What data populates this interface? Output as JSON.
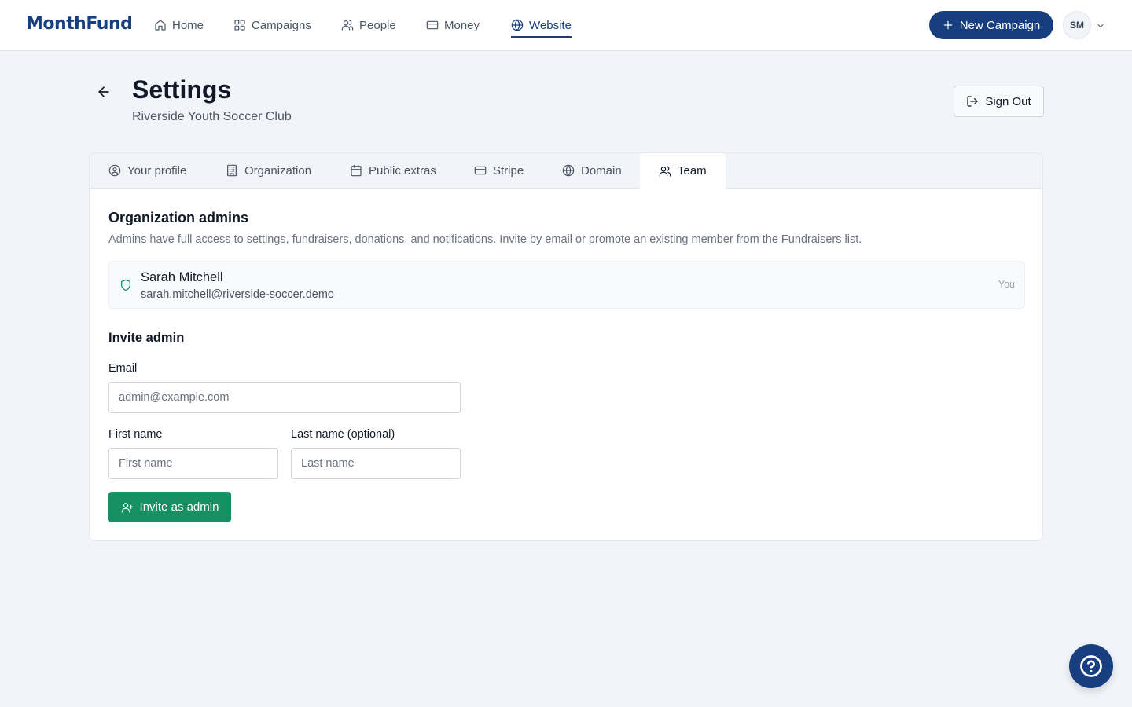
{
  "app": {
    "logo": "MonthFund"
  },
  "nav": {
    "items": [
      {
        "label": "Home",
        "icon": "home-icon"
      },
      {
        "label": "Campaigns",
        "icon": "grid-icon"
      },
      {
        "label": "People",
        "icon": "users-icon"
      },
      {
        "label": "Money",
        "icon": "credit-card-icon"
      },
      {
        "label": "Website",
        "icon": "globe-icon",
        "active": true
      }
    ],
    "new_campaign_label": "New Campaign",
    "avatar_initials": "SM"
  },
  "header": {
    "title": "Settings",
    "subtitle": "Riverside Youth Soccer Club",
    "sign_out_label": "Sign Out"
  },
  "tabs": [
    {
      "label": "Your profile",
      "icon": "user-circle-icon"
    },
    {
      "label": "Organization",
      "icon": "building-icon"
    },
    {
      "label": "Public extras",
      "icon": "calendar-icon"
    },
    {
      "label": "Stripe",
      "icon": "credit-card-icon"
    },
    {
      "label": "Domain",
      "icon": "globe-icon"
    },
    {
      "label": "Team",
      "icon": "users-icon",
      "active": true
    }
  ],
  "admins": {
    "title": "Organization admins",
    "description": "Admins have full access to settings, fundraisers, donations, and notifications. Invite by email or promote an existing member from the Fundraisers list.",
    "list": [
      {
        "name": "Sarah Mitchell",
        "email": "sarah.mitchell@riverside-soccer.demo",
        "tag": "You"
      }
    ]
  },
  "invite": {
    "title": "Invite admin",
    "email_label": "Email",
    "email_placeholder": "admin@example.com",
    "email_value": "",
    "first_name_label": "First name",
    "first_name_placeholder": "First name",
    "last_name_label": "Last name (optional)",
    "last_name_placeholder": "Last name",
    "button_label": "Invite as admin"
  },
  "colors": {
    "brand": "#173f7f",
    "success": "#168f63",
    "background": "#f1f4f8"
  }
}
